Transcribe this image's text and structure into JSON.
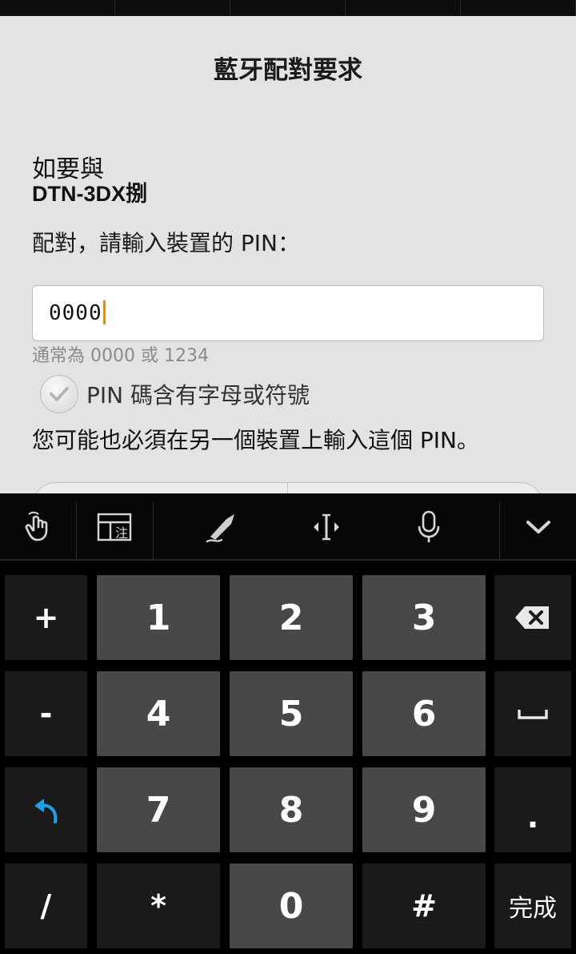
{
  "dialog": {
    "title": "藍牙配對要求",
    "prefix": "如要與",
    "device_name": "DTN-3DX捌",
    "instruction": "配對，請輸入裝置的 PIN：",
    "pin_value": "0000",
    "hint": "通常為 0000 或 1234",
    "checkbox_label": "PIN 碼含有字母或符號",
    "checkbox_checked": false,
    "note": "您可能也必須在另一個裝置上輸入這個 PIN。"
  },
  "toolbar": {
    "icons": [
      "touch-gesture-icon",
      "input-mode-icon",
      "handwriting-icon",
      "cursor-move-icon",
      "microphone-icon",
      "collapse-keyboard-icon"
    ]
  },
  "keyboard": {
    "keys": {
      "plus": "+",
      "minus": "-",
      "slash": "/",
      "one": "1",
      "two": "2",
      "three": "3",
      "four": "4",
      "five": "5",
      "six": "6",
      "seven": "7",
      "eight": "8",
      "nine": "9",
      "star": "*",
      "zero": "0",
      "hash": "#",
      "period": ".",
      "done": "完成"
    },
    "colors": {
      "dark_key": "#1a1a1a",
      "light_key": "#484848",
      "accent_blue": "#1aa3e8"
    }
  }
}
